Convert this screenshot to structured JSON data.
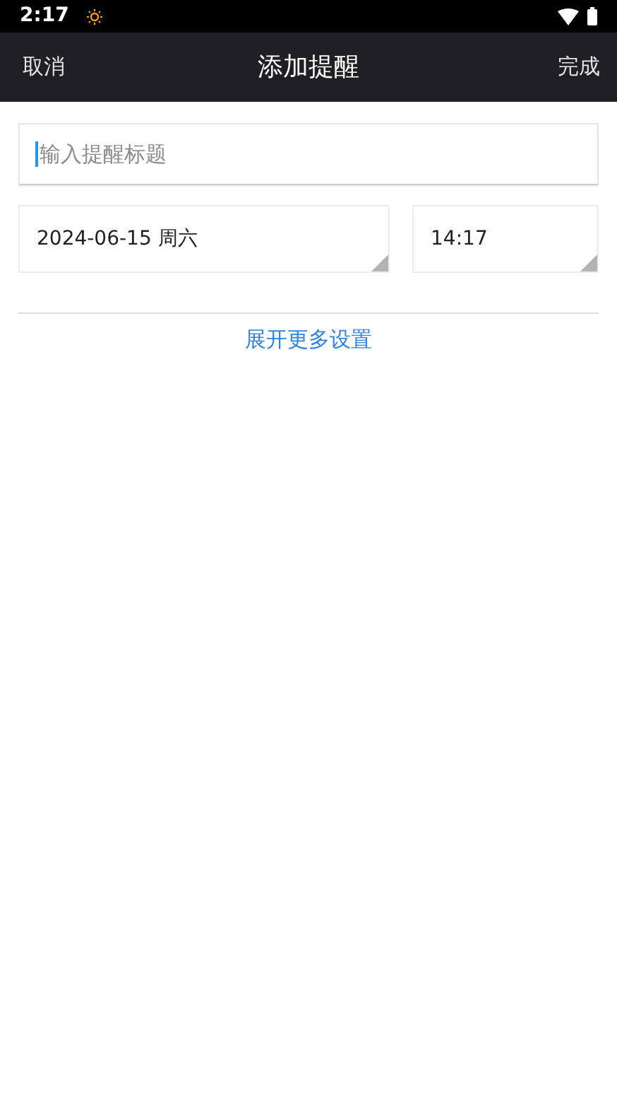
{
  "status_bar": {
    "time": "2:17"
  },
  "header": {
    "cancel": "取消",
    "title": "添加提醒",
    "done": "完成"
  },
  "title_field": {
    "placeholder": "输入提醒标题"
  },
  "date_picker": {
    "value": "2024-06-15 周六"
  },
  "time_picker": {
    "value": "14:17"
  },
  "more_settings_link": "展开更多设置"
}
